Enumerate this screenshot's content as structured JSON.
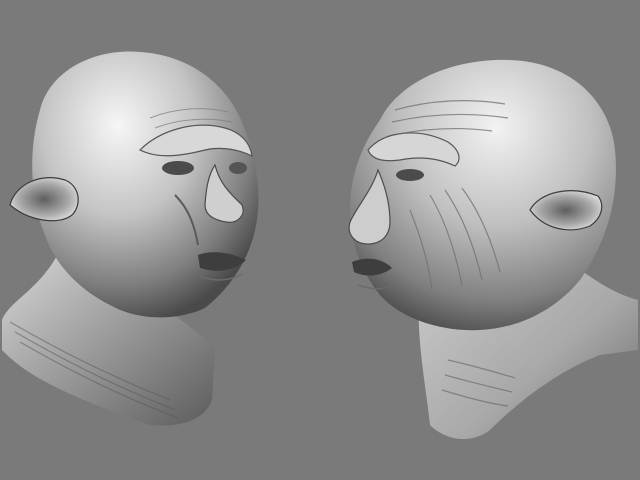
{
  "scene": {
    "background_color": "#7a7a7a",
    "subjects": [
      {
        "name": "left-sculpted-head",
        "facing": "right"
      },
      {
        "name": "right-sculpted-head",
        "facing": "left"
      }
    ],
    "material_colors": {
      "highlight": "#f4f4f4",
      "midtone": "#b8b8b8",
      "shadow": "#3a3a3a"
    }
  }
}
